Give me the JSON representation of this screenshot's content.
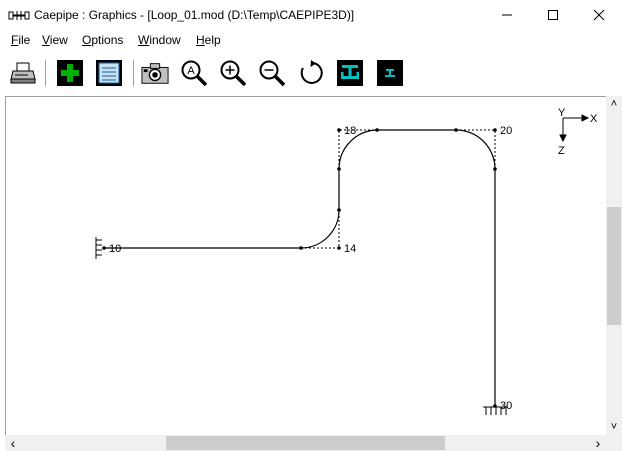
{
  "window": {
    "title": "Caepipe : Graphics -  [Loop_01.mod (D:\\Temp\\CAEPIPE3D)]",
    "controls": {
      "minimize": "—",
      "maximize": "☐",
      "close": "✕"
    }
  },
  "menu": [
    {
      "accel": "F",
      "rest": "ile"
    },
    {
      "accel": "V",
      "rest": "iew"
    },
    {
      "accel": "O",
      "rest": "ptions"
    },
    {
      "accel": "W",
      "rest": "indow"
    },
    {
      "accel": "H",
      "rest": "elp"
    }
  ],
  "toolbar": {
    "icons": [
      "print-icon",
      "add-icon",
      "list-icon",
      "camera-icon",
      "zoom-auto-icon",
      "zoom-in-icon",
      "zoom-out-icon",
      "rotate-icon",
      "support-icon",
      "support-small-icon"
    ]
  },
  "drawing": {
    "nodes": [
      "10",
      "14",
      "18",
      "20",
      "30"
    ],
    "axes": {
      "y": "Y",
      "x": "X",
      "z": "Z"
    }
  },
  "scroll": {
    "left_arrow": "‹",
    "right_arrow": "›",
    "up_arrow": "˄",
    "down_arrow": "˅"
  },
  "colors": {
    "toolbar_dark": "#000000",
    "accent_green": "#00b000",
    "accent_cyan": "#00c0c0"
  }
}
